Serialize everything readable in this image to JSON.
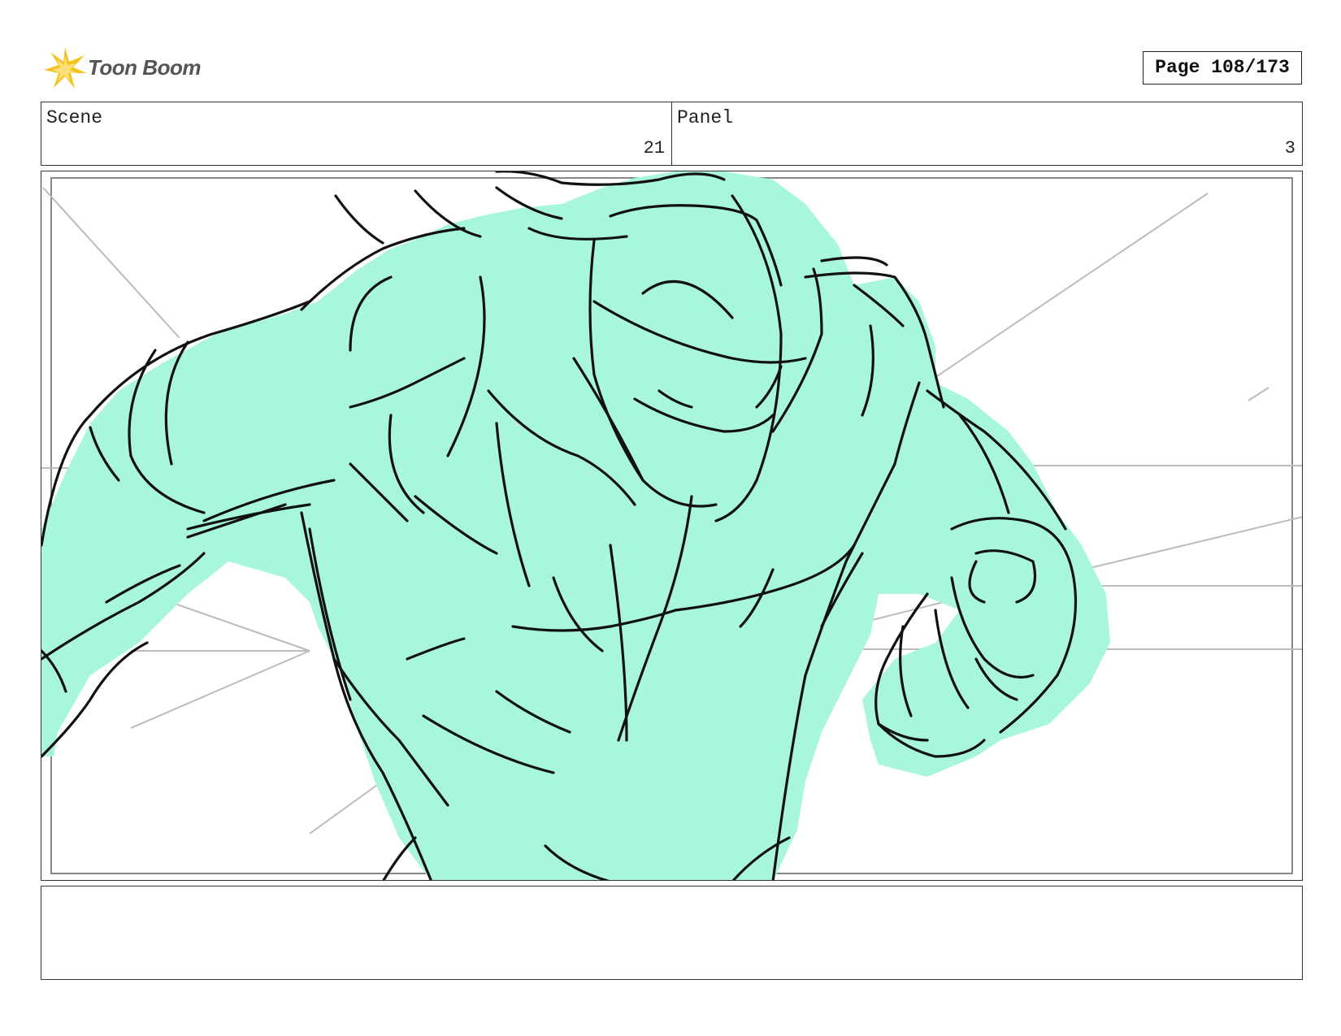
{
  "brand": {
    "name": "Toon Boom",
    "icon": "toon-boom-star-icon",
    "accent": "#f2b705"
  },
  "page": {
    "label": "Page 108/173"
  },
  "header": {
    "scene_label": "Scene",
    "scene_value": "21",
    "panel_label": "Panel",
    "panel_value": "3"
  },
  "panel": {
    "image": "storyboard-sketch",
    "fill_color": "#a8f7dc",
    "line_color": "#111111"
  },
  "notes": {
    "text": ""
  }
}
